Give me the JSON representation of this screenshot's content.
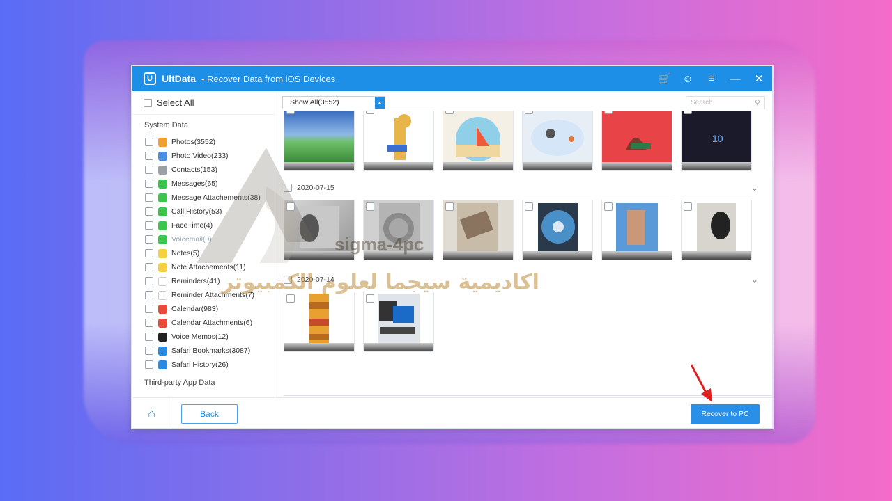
{
  "app": {
    "name": "UltData",
    "subtitle": "- Recover Data from iOS Devices",
    "logo_glyph": "U"
  },
  "titlebar_icons": [
    "cart-icon",
    "user-icon",
    "menu-icon",
    "minimize-icon",
    "close-icon"
  ],
  "sidebar": {
    "select_all": "Select All",
    "system_header": "System Data",
    "items": [
      {
        "label": "Photos(3552)",
        "icon": "photos-icon",
        "color": "#f0a030"
      },
      {
        "label": "Photo Video(233)",
        "icon": "photo-video-icon",
        "color": "#4a90e2"
      },
      {
        "label": "Contacts(153)",
        "icon": "contacts-icon",
        "color": "#9aa0a6"
      },
      {
        "label": "Messages(65)",
        "icon": "messages-icon",
        "color": "#3cc44c"
      },
      {
        "label": "Message Attachements(38)",
        "icon": "message-attachments-icon",
        "color": "#3cc44c"
      },
      {
        "label": "Call History(53)",
        "icon": "call-history-icon",
        "color": "#3cc44c"
      },
      {
        "label": "FaceTime(4)",
        "icon": "facetime-icon",
        "color": "#3cc44c"
      },
      {
        "label": "Voicemail(0)",
        "icon": "voicemail-icon",
        "color": "#3cc44c"
      },
      {
        "label": "Notes(5)",
        "icon": "notes-icon",
        "color": "#f5d142"
      },
      {
        "label": "Note Attachements(11)",
        "icon": "note-attachments-icon",
        "color": "#f5d142"
      },
      {
        "label": "Reminders(41)",
        "icon": "reminders-icon",
        "color": "#ffffff"
      },
      {
        "label": "Reminder Attachments(7)",
        "icon": "reminder-attachments-icon",
        "color": "#ffffff"
      },
      {
        "label": "Calendar(983)",
        "icon": "calendar-icon",
        "color": "#e84a3a"
      },
      {
        "label": "Calendar Attachments(6)",
        "icon": "calendar-attachments-icon",
        "color": "#e84a3a"
      },
      {
        "label": "Voice Memos(12)",
        "icon": "voice-memos-icon",
        "color": "#222222"
      },
      {
        "label": "Safari Bookmarks(3087)",
        "icon": "safari-bookmarks-icon",
        "color": "#2a8be0"
      },
      {
        "label": "Safari History(26)",
        "icon": "safari-history-icon",
        "color": "#2a8be0"
      }
    ],
    "third_party_header": "Third-party App Data"
  },
  "toolbar": {
    "filter_value": "Show All(3552)",
    "search_placeholder": "Search"
  },
  "groups": [
    {
      "date": "2020-07-15"
    },
    {
      "date": "2020-07-14"
    }
  ],
  "footer": {
    "back_label": "Back",
    "recover_label": "Recover to PC"
  },
  "watermark": {
    "latin": "sigma-4pc",
    "arabic": "اكاديمية سيجما لعلوم الكمبيوتر"
  },
  "colors": {
    "accent": "#1d8fe6",
    "arrow": "#e02020"
  }
}
